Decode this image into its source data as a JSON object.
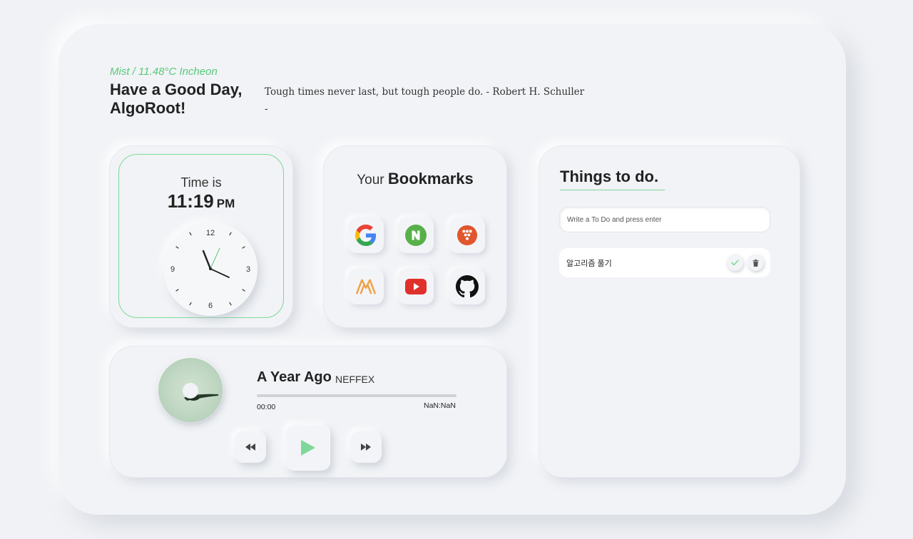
{
  "header": {
    "weather": "Mist / 11.48°C Incheon",
    "greeting_line1": "Have a Good Day,",
    "greeting_line2": "AlgoRoot!",
    "quote": "Tough times never last, but tough people do. - Robert H. Schuller",
    "quote_author": "-"
  },
  "clock": {
    "label": "Time is",
    "time": "11:19",
    "ampm": "PM",
    "numbers": [
      "12",
      "3",
      "6",
      "9"
    ]
  },
  "bookmarks": {
    "title_prefix": "Your",
    "title_bold": "Bookmarks",
    "items": [
      {
        "icon": "google-icon",
        "color": "#4285f4"
      },
      {
        "icon": "naver-icon",
        "color": "#58b04a"
      },
      {
        "icon": "dotted-app-icon",
        "color": "#e0562d"
      },
      {
        "icon": "mountain-logo-icon",
        "color": "#f0a043"
      },
      {
        "icon": "youtube-icon",
        "color": "#e0302b"
      },
      {
        "icon": "github-icon",
        "color": "#111111"
      }
    ]
  },
  "todo": {
    "title": "Things to do.",
    "placeholder": "Write a To Do and press enter",
    "items": [
      {
        "text": "알고리즘 풀기"
      }
    ],
    "accent": "#7ed89a"
  },
  "player": {
    "song": "A Year Ago",
    "artist": "NEFFEX",
    "current_time": "00:00",
    "total_time": "NaN:NaN",
    "progress": 0
  },
  "colors": {
    "accent_green": "#58c97a",
    "background": "#f1f3f6"
  }
}
